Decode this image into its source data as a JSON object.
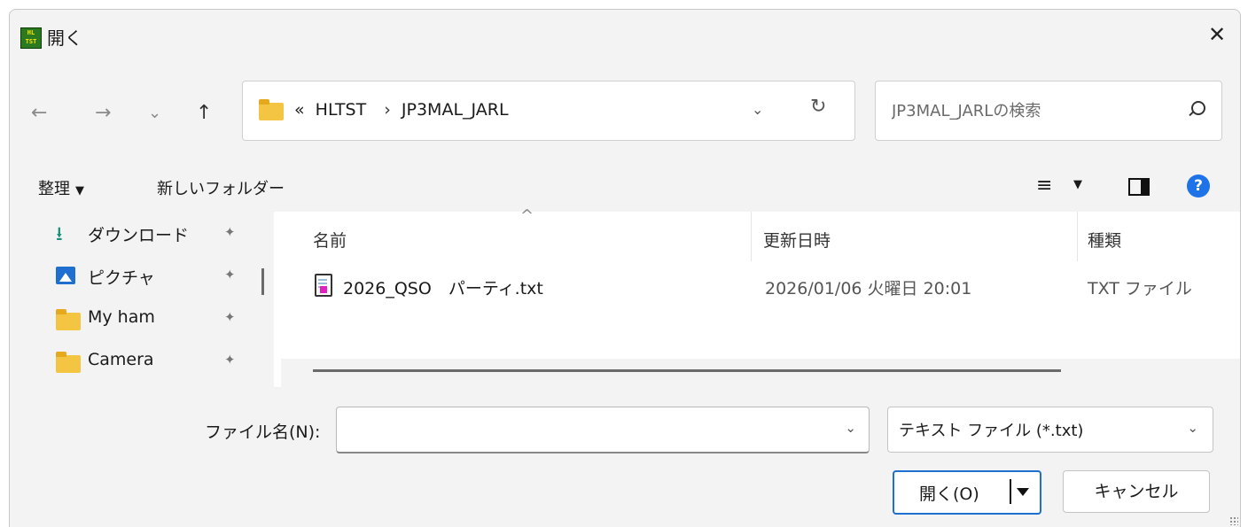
{
  "window": {
    "app_icon": "hltst-app-icon",
    "title": "開く",
    "close_glyph": "✕"
  },
  "nav": {
    "back": "←",
    "forward": "→",
    "recent": "⌄",
    "up": "↑"
  },
  "address": {
    "overflow": "«",
    "path": [
      "HLTST",
      "JP3MAL_JARL"
    ],
    "separator": "›",
    "dropdown_glyph": "⌄",
    "refresh_glyph": "↻"
  },
  "search": {
    "placeholder": "JP3MAL_JARLの検索"
  },
  "commandbar": {
    "organize_label": "整理",
    "organize_caret": "▼",
    "new_folder_label": "新しいフォルダー",
    "view_glyph": "≡",
    "view_caret": "▼",
    "help_glyph": "?"
  },
  "sidebar": {
    "items": [
      {
        "label": "ダウンロード",
        "icon": "download-icon",
        "pinned": true
      },
      {
        "label": "ピクチャ",
        "icon": "pictures-icon",
        "pinned": true
      },
      {
        "label": "My ham",
        "icon": "folder-icon",
        "pinned": true
      },
      {
        "label": "Camera",
        "icon": "folder-icon",
        "pinned": true
      }
    ],
    "pin_glyph": "📌"
  },
  "filelist": {
    "sort_glyph": "^",
    "columns": [
      "名前",
      "更新日時",
      "種類"
    ],
    "rows": [
      {
        "name": "2026_QSO　パーティ.txt",
        "modified": "2026/01/06 火曜日 20:01",
        "type": "TXT ファイル"
      }
    ]
  },
  "footer": {
    "filename_label": "ファイル名(N):",
    "filename_value": "",
    "filename_chevron": "⌄",
    "filter_value": "テキスト ファイル (*.txt)",
    "filter_chevron": "⌄",
    "open_label": "開く(O)",
    "cancel_label": "キャンセル"
  },
  "colors": {
    "accent": "#1e6fd0",
    "folder": "#f4c542",
    "background": "#f3f3f3"
  }
}
